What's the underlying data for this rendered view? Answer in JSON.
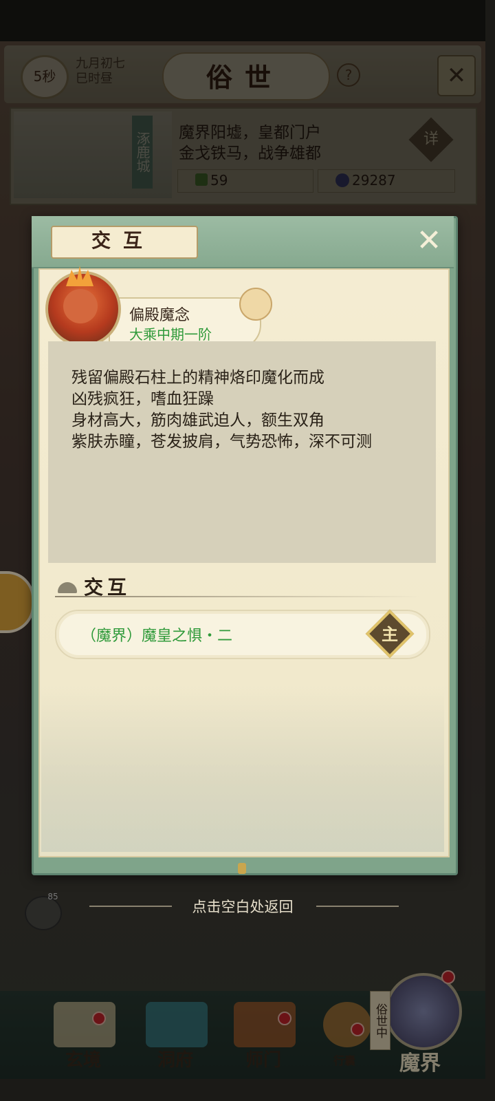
{
  "header": {
    "timer": "5秒",
    "date_line1": "九月初七",
    "date_line2": "巳时昼",
    "title": "俗世",
    "help_symbol": "?",
    "close_symbol": "✕"
  },
  "city": {
    "name": "涿鹿城",
    "desc_line1": "魔界阳墟，皇都门户",
    "desc_line2": "金戈铁马，战争雄都",
    "detail_label": "详",
    "resource1_value": "59",
    "resource2_value": "29287"
  },
  "dialog": {
    "title": "交互",
    "close_symbol": "✕",
    "npc": {
      "name": "偏殿魔念",
      "rank": "大乘中期一阶",
      "description": [
        "残留偏殿石柱上的精神烙印魔化而成",
        "凶残疯狂，嗜血狂躁",
        "身材高大，筋肉雄武迫人，额生双角",
        "紫肤赤瞳，苍发披肩，气势恐怖，深不可测"
      ]
    },
    "section_title": "交互",
    "interactions": [
      {
        "label": "（魔界）魔皇之惧・二",
        "badge": "主"
      }
    ]
  },
  "chat": {
    "count": "85"
  },
  "return_hint": "点击空白处返回",
  "bottom_nav": {
    "items": [
      {
        "label": "玄境"
      },
      {
        "label": "洞府"
      },
      {
        "label": "师门"
      },
      {
        "label": "行囊"
      },
      {
        "label": "魔界"
      }
    ],
    "realm_tag": "俗世中"
  },
  "colors": {
    "accent_green": "#2f9a3a",
    "dialog_frame": "#7fa48a",
    "paper": "#f4ecd2",
    "badge_red": "#c4232a"
  }
}
